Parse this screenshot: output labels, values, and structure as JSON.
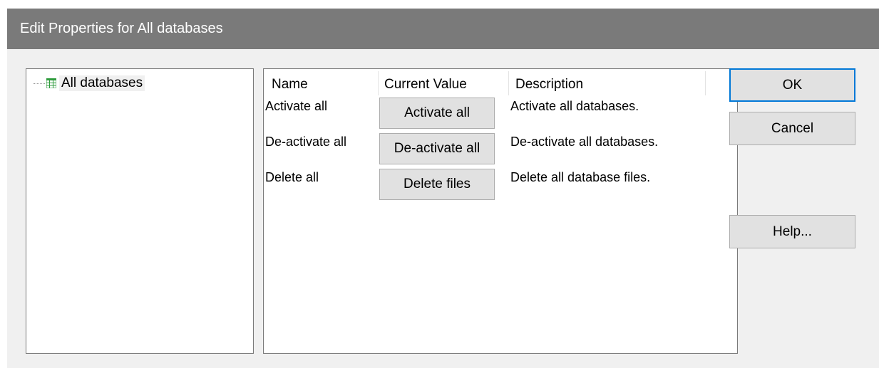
{
  "window": {
    "title": "Edit Properties for All databases"
  },
  "tree": {
    "items": [
      {
        "label": "All databases",
        "icon": "database-grid-icon"
      }
    ]
  },
  "properties": {
    "columns": [
      "Name",
      "Current Value",
      "Description"
    ],
    "rows": [
      {
        "name": "Activate all",
        "button": "Activate all",
        "description": "Activate all databases."
      },
      {
        "name": "De-activate all",
        "button": "De-activate all",
        "description": "De-activate all databases."
      },
      {
        "name": "Delete all",
        "button": "Delete files",
        "description": "Delete all database files."
      }
    ]
  },
  "buttons": {
    "ok": "OK",
    "cancel": "Cancel",
    "help": "Help..."
  },
  "colors": {
    "titlebar": "#7a7a7a",
    "dialog_bg": "#f0f0f0",
    "button_bg": "#e1e1e1",
    "focus_border": "#0078d7",
    "icon_green": "#2e9b3c"
  }
}
